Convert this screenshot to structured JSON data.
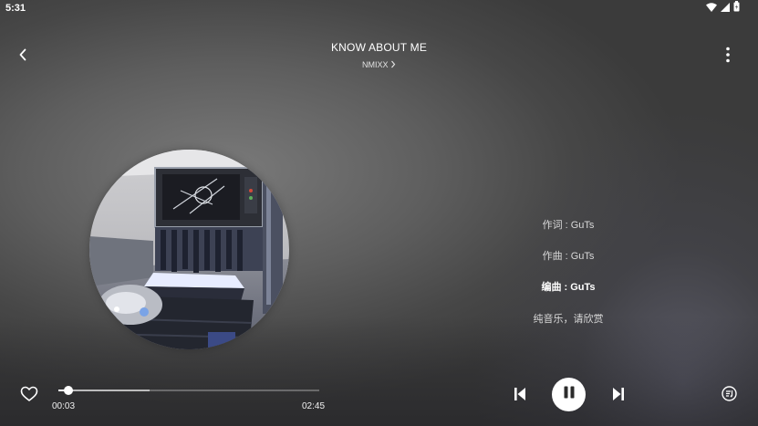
{
  "status_bar": {
    "time": "5:31",
    "icons": [
      "wifi-icon",
      "cell-signal-icon",
      "battery-icon"
    ]
  },
  "header": {
    "back_icon": "chevron-left-icon",
    "title": "KNOW ABOUT ME",
    "artist": "NMIXX",
    "artist_chevron": "›",
    "more_icon": "more-vertical-icon"
  },
  "album": {
    "art": "album-cover-image"
  },
  "lyrics": {
    "lines": [
      {
        "text": "作词 : GuTs",
        "active": false
      },
      {
        "text": "作曲 : GuTs",
        "active": false
      },
      {
        "text": "编曲 : GuTs",
        "active": true
      },
      {
        "text": "纯音乐，请欣赏",
        "active": false
      }
    ]
  },
  "player": {
    "current_time": "00:03",
    "total_time": "02:45",
    "progress_fraction": 0.04,
    "buffered_fraction": 0.35,
    "liked": false,
    "playing": true,
    "like_icon": "heart-outline-icon",
    "prev_icon": "skip-previous-icon",
    "play_pause_icon": "pause-icon",
    "next_icon": "skip-next-icon",
    "playlist_icon": "playlist-icon"
  },
  "colors": {
    "accent": "#ffffff",
    "background": "#5a5a5a"
  }
}
